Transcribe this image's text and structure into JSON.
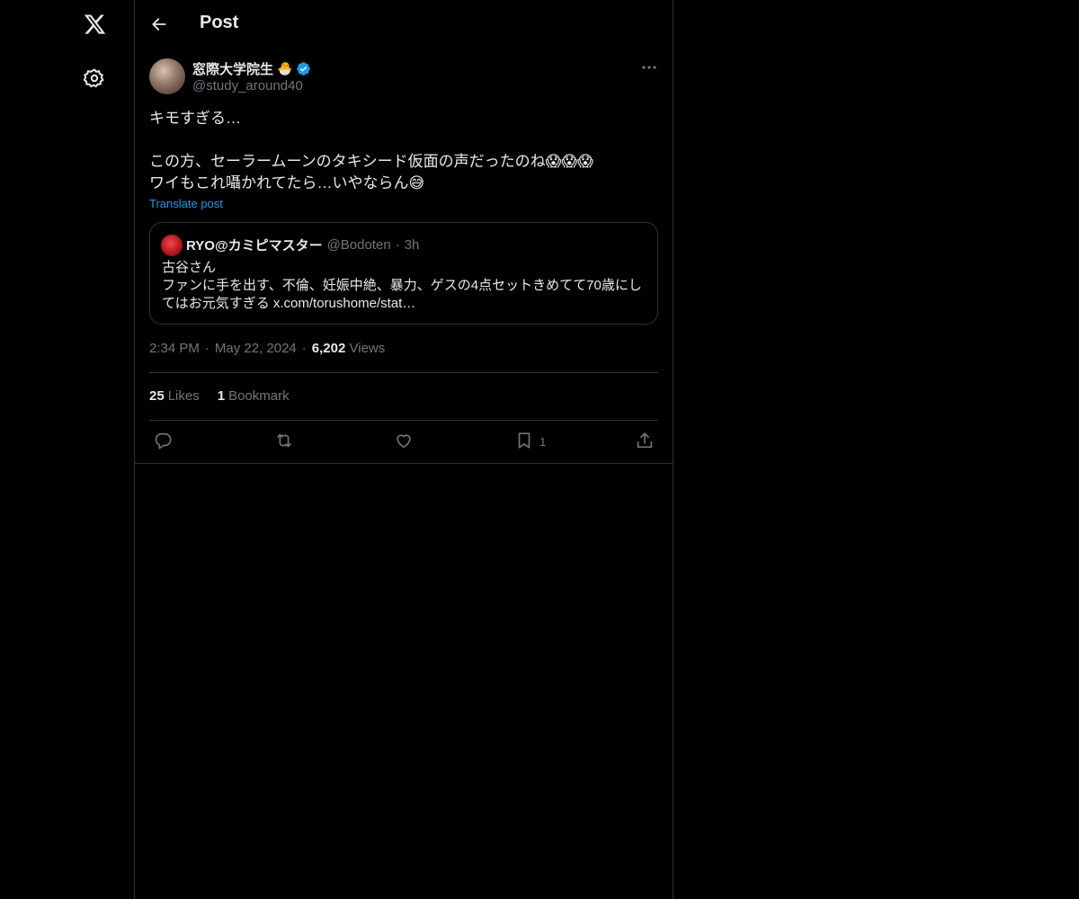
{
  "header": {
    "title": "Post"
  },
  "author": {
    "display_name": "窓際大学院生",
    "name_emoji": "🐣",
    "handle": "@study_around40",
    "verified_color": "#1d9bf0"
  },
  "post": {
    "lines": [
      "キモすぎる…",
      "",
      "この方、セーラームーンのタキシード仮面の声だったのね😱😱😱",
      "ワイもこれ囁かれてたら…いやならん😅"
    ],
    "translate_label": "Translate post"
  },
  "quote": {
    "name": "RYO@カミピマスター",
    "handle": "@Bodoten",
    "separator": "·",
    "time": "3h",
    "lines": [
      "古谷さん",
      "ファンに手を出す、不倫、妊娠中絶、暴力、ゲスの4点セットきめてて70歳にし",
      "てはお元気すぎる x.com/torushome/stat…"
    ]
  },
  "meta": {
    "time": "2:34 PM",
    "separator": "·",
    "date": "May 22, 2024",
    "views_count": "6,202",
    "views_label": "Views"
  },
  "stats": {
    "likes_count": "25",
    "likes_label": "Likes",
    "bookmarks_count": "1",
    "bookmarks_label": "Bookmark"
  },
  "actions": {
    "bookmark_count": "1"
  },
  "icons": [
    "x-logo-icon",
    "settings-icon",
    "back-arrow-icon",
    "verified-icon",
    "more-icon",
    "reply-icon",
    "repost-icon",
    "like-icon",
    "bookmark-icon",
    "share-icon"
  ]
}
